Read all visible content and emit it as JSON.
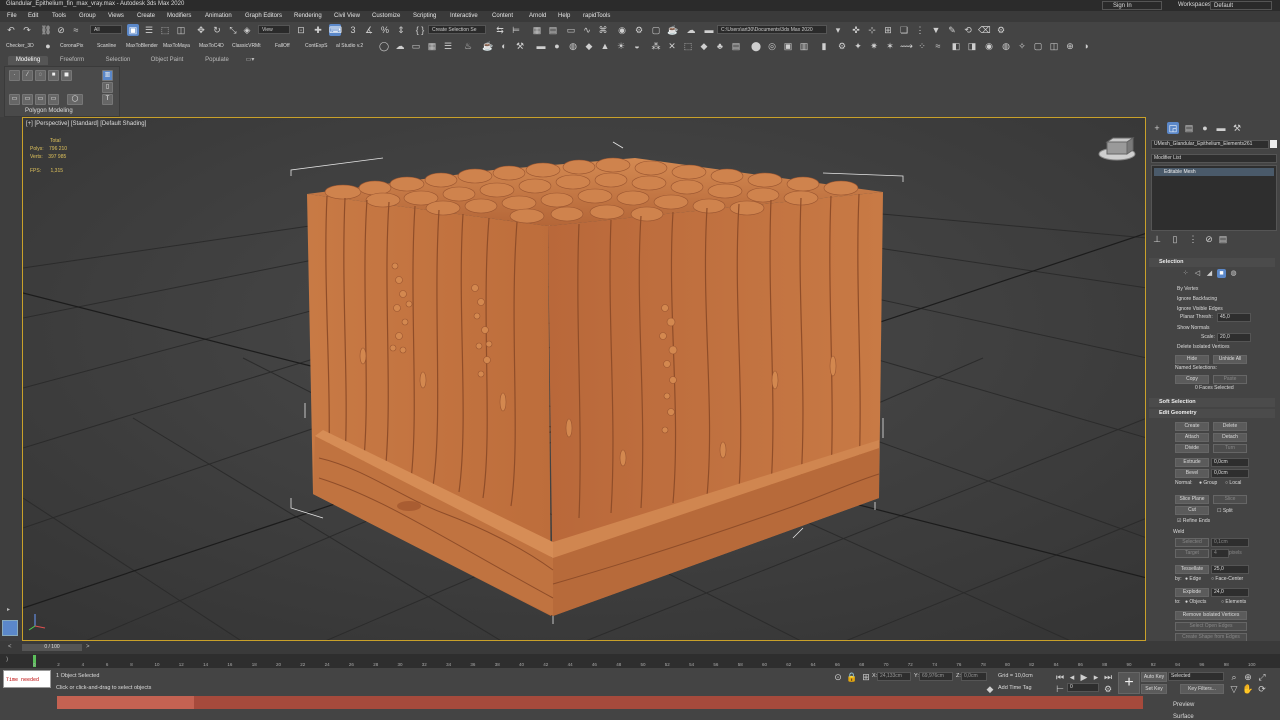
{
  "window": {
    "title": "Glandular_Epithelium_fin_max_vray.max - Autodesk 3ds Max 2020",
    "signin": "Sign In",
    "workspace_label": "Workspaces:",
    "workspace_value": "Default"
  },
  "menu": [
    "File",
    "Edit",
    "Tools",
    "Group",
    "Views",
    "Create",
    "Modifiers",
    "Animation",
    "Graph Editors",
    "Rendering",
    "Civil View",
    "Customize",
    "Scripting",
    "Interactive",
    "Content",
    "Arnold",
    "Help",
    "rapidTools"
  ],
  "toolbar": {
    "filter_value": "All",
    "view_value": "View",
    "selection_set_placeholder": "Create Selection Se",
    "project_path": "C:\\Users\\art30\\Documents\\3ds Max 2020"
  },
  "plugins": [
    "Checker_3D",
    "CoronaPix",
    "Scanline",
    "MaxToBlender",
    "MaxToMaya",
    "MaxToC4D",
    "ClassicVRMt",
    "FallOff",
    "ContExpS",
    "al Studio v.2"
  ],
  "ribbon": {
    "tabs": [
      "Modeling",
      "Freeform",
      "Selection",
      "Object Paint",
      "Populate"
    ],
    "panel_label": "Polygon Modeling"
  },
  "viewport": {
    "label": "[+] [Perspective] [Standard] [Default Shading]",
    "stats_total": "Total",
    "polys_label": "Polys:",
    "polys_value": "796 210",
    "verts_label": "Verts:",
    "verts_value": "397 985",
    "fps_label": "FPS:",
    "fps_value": "1,315",
    "model_color": "#c87a45",
    "grid_color": "#2f2f2f",
    "border_color": "#c9a12a"
  },
  "cmdpanel": {
    "object_name": "UMesh_Glandular_Epithelium_Elements261",
    "modifier_list": "Modifier List",
    "stack_item": "Editable Mesh",
    "selection": {
      "header": "Selection",
      "by_vertex": "By Vertex",
      "ignore_backfacing": "Ignore Backfacing",
      "ignore_visible_edges": "Ignore Visible Edges",
      "planar_thresh_label": "Planar Thresh:",
      "planar_thresh_value": "45,0",
      "show_normals": "Show Normals",
      "scale_label": "Scale:",
      "scale_value": "20,0",
      "delete_isolated": "Delete Isolated Vertices",
      "hide": "Hide",
      "unhide_all": "Unhide All",
      "named_selections": "Named Selections:",
      "copy": "Copy",
      "paste": "Paste",
      "faces_selected": "0 Faces Selected"
    },
    "soft_selection": "Soft Selection",
    "edit_geometry": {
      "header": "Edit Geometry",
      "create": "Create",
      "delete": "Delete",
      "attach": "Attach",
      "detach": "Detach",
      "divide": "Divide",
      "turn": "Turn",
      "extrude": "Extrude",
      "extrude_value": "0,0cm",
      "bevel": "Bevel",
      "bevel_value": "0,0cm",
      "normal_label": "Normal:",
      "group": "Group",
      "local": "Local",
      "slice_plane": "Slice Plane",
      "slice": "Slice",
      "cut": "Cut",
      "split": "Split",
      "refine_ends": "Refine Ends",
      "weld": "Weld",
      "selected": "Selected",
      "selected_value": "0,1cm",
      "target": "Target",
      "target_value": "4",
      "pixels": "pixels",
      "tessellate": "Tessellate",
      "tessellate_value": "25,0",
      "by_label": "by:",
      "edge": "Edge",
      "face_center": "Face-Center",
      "explode": "Explode",
      "explode_value": "24,0",
      "to_label": "to:",
      "objects": "Objects",
      "elements": "Elements",
      "remove_isolated": "Remove Isolated Vertices",
      "select_open_edges": "Select Open Edges",
      "create_shape": "Create Shape from Edges"
    }
  },
  "timeline": {
    "slider": "0 / 100",
    "ticks": [
      "0",
      "2",
      "4",
      "6",
      "8",
      "10",
      "12",
      "14",
      "16",
      "18",
      "20",
      "22",
      "24",
      "26",
      "28",
      "30",
      "32",
      "34",
      "36",
      "38",
      "40",
      "42",
      "44",
      "46",
      "48",
      "50",
      "52",
      "54",
      "56",
      "58",
      "60",
      "62",
      "64",
      "66",
      "68",
      "70",
      "72",
      "74",
      "76",
      "78",
      "80",
      "82",
      "84",
      "86",
      "88",
      "90",
      "92",
      "94",
      "96",
      "98",
      "100"
    ]
  },
  "status": {
    "maxscript": "Time needed",
    "objects_selected": "1 Object Selected",
    "prompt": "Click or click-and-drag to select objects",
    "x_label": "X:",
    "x_value": "24,133cm",
    "y_label": "Y:",
    "y_value": "69,976cm",
    "z_label": "Z:",
    "z_value": "0,0cm",
    "grid": "Grid = 10,0cm",
    "add_time_tag": "Add Time Tag",
    "autokey": "Auto Key",
    "selected": "Selected",
    "setkey": "Set Key",
    "key_filters": "Key Filters...",
    "frame": "0",
    "preview": "Preview",
    "surface": "Surface"
  }
}
